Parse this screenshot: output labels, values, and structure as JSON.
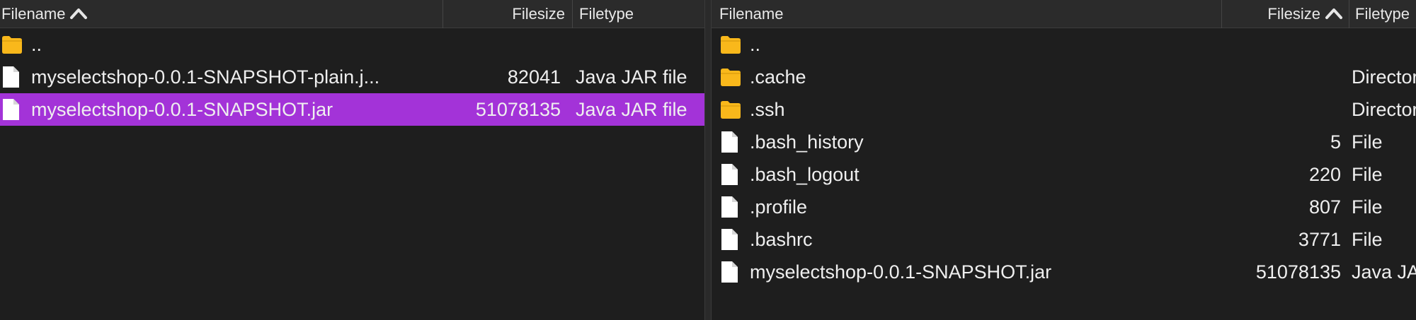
{
  "left_pane": {
    "columns": {
      "filename": "Filename",
      "filesize": "Filesize",
      "filetype": "Filetype"
    },
    "sort": {
      "column": "Filename",
      "direction": "ascending",
      "icon": "chevron-up-icon"
    },
    "rows": [
      {
        "icon": "folder-icon",
        "name": "..",
        "size": "",
        "type": "",
        "selected": false
      },
      {
        "icon": "file-icon",
        "name": "myselectshop-0.0.1-SNAPSHOT-plain.j...",
        "size": "82041",
        "type": "Java JAR file",
        "selected": false
      },
      {
        "icon": "file-icon",
        "name": "myselectshop-0.0.1-SNAPSHOT.jar",
        "size": "51078135",
        "type": "Java JAR file",
        "selected": true
      }
    ]
  },
  "right_pane": {
    "columns": {
      "filename": "Filename",
      "filesize": "Filesize",
      "filetype": "Filetype"
    },
    "sort": {
      "column": "Filesize",
      "direction": "ascending",
      "icon": "chevron-up-icon"
    },
    "rows": [
      {
        "icon": "folder-icon",
        "name": "..",
        "size": "",
        "type": "",
        "selected": false
      },
      {
        "icon": "folder-icon",
        "name": ".cache",
        "size": "",
        "type": "Directory",
        "selected": false
      },
      {
        "icon": "folder-icon",
        "name": ".ssh",
        "size": "",
        "type": "Directory",
        "selected": false
      },
      {
        "icon": "file-icon",
        "name": ".bash_history",
        "size": "5",
        "type": "File",
        "selected": false
      },
      {
        "icon": "file-icon",
        "name": ".bash_logout",
        "size": "220",
        "type": "File",
        "selected": false
      },
      {
        "icon": "file-icon",
        "name": ".profile",
        "size": "807",
        "type": "File",
        "selected": false
      },
      {
        "icon": "file-icon",
        "name": ".bashrc",
        "size": "3771",
        "type": "File",
        "selected": false
      },
      {
        "icon": "file-icon",
        "name": "myselectshop-0.0.1-SNAPSHOT.jar",
        "size": "51078135",
        "type": "Java JAR file",
        "selected": false
      }
    ]
  },
  "colors": {
    "background": "#1e1e1e",
    "header_background": "#2b2b2b",
    "selection": "#a333d8",
    "folder": "#f9b81b",
    "file": "#ffffff",
    "text": "#efefef"
  }
}
